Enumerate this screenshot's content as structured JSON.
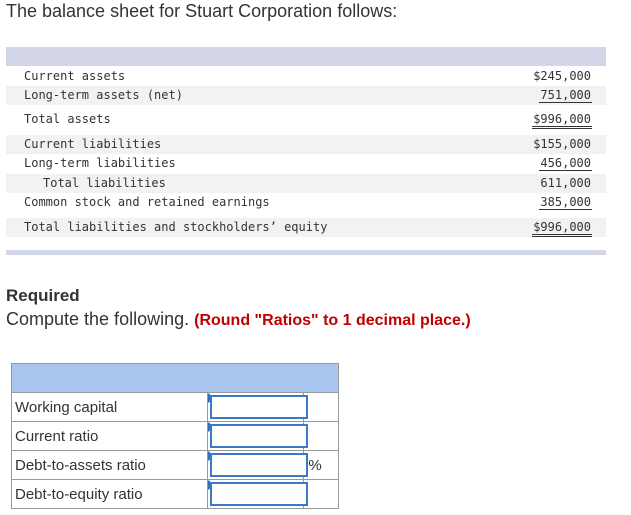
{
  "intro": "The balance sheet for Stuart Corporation follows:",
  "balance_sheet": {
    "rows": [
      {
        "label": "Current assets",
        "amount": "$245,000"
      },
      {
        "label": "Long-term assets (net)",
        "amount": "751,000"
      },
      {
        "label": "Total assets",
        "amount": "$996,000"
      },
      {
        "label": "Current liabilities",
        "amount": "$155,000"
      },
      {
        "label": "Long-term liabilities",
        "amount": "456,000"
      },
      {
        "label": "Total liabilities",
        "amount": "611,000"
      },
      {
        "label": "Common stock and retained earnings",
        "amount": "385,000"
      },
      {
        "label": "Total liabilities and stockholders’ equity",
        "amount": "$996,000"
      }
    ]
  },
  "required": {
    "title": "Required",
    "text": "Compute the following.",
    "note": "(Round \"Ratios\" to 1 decimal place.)"
  },
  "answers": {
    "rows": [
      {
        "label": "Working capital",
        "value": "",
        "unit": ""
      },
      {
        "label": "Current ratio",
        "value": "",
        "unit": ""
      },
      {
        "label": "Debt-to-assets ratio",
        "value": "",
        "unit": "%"
      },
      {
        "label": "Debt-to-equity ratio",
        "value": "",
        "unit": ""
      }
    ]
  }
}
